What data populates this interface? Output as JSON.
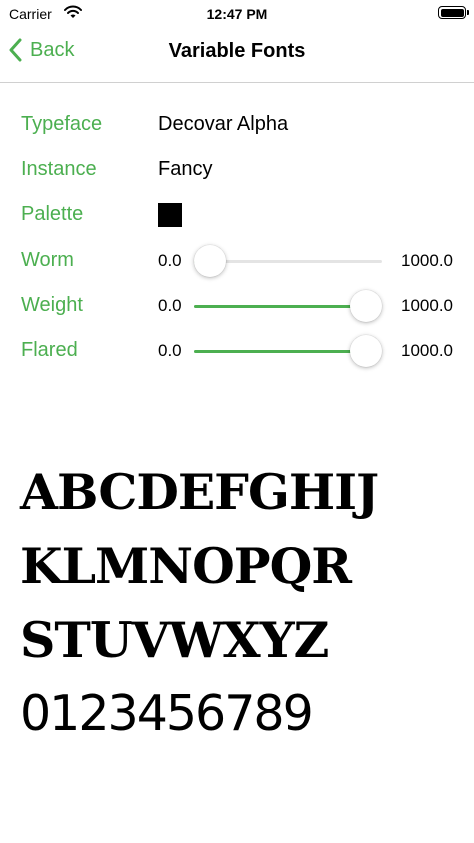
{
  "status_bar": {
    "carrier": "Carrier",
    "time": "12:47 PM",
    "icons": [
      "wifi-icon",
      "battery-icon"
    ]
  },
  "nav": {
    "back_label": "Back",
    "title": "Variable Fonts",
    "back_icon": "chevron-left-icon"
  },
  "settings": {
    "typeface": {
      "label": "Typeface",
      "value": "Decovar Alpha"
    },
    "instance": {
      "label": "Instance",
      "value": "Fancy"
    },
    "palette": {
      "label": "Palette",
      "color": "#000000"
    },
    "worm": {
      "label": "Worm",
      "min": "0.0",
      "max": "1000.0",
      "value": 0
    },
    "weight": {
      "label": "Weight",
      "min": "0.0",
      "max": "1000.0",
      "value": 1000
    },
    "flared": {
      "label": "Flared",
      "min": "0.0",
      "max": "1000.0",
      "value": 1000
    }
  },
  "sample_text": {
    "lines": [
      "ABCDEFGHIJ",
      "KLMNOPQR",
      "STUVWXYZ",
      "0123456789"
    ]
  },
  "colors": {
    "accent": "#4caf50",
    "track": "#e4e4e4"
  }
}
